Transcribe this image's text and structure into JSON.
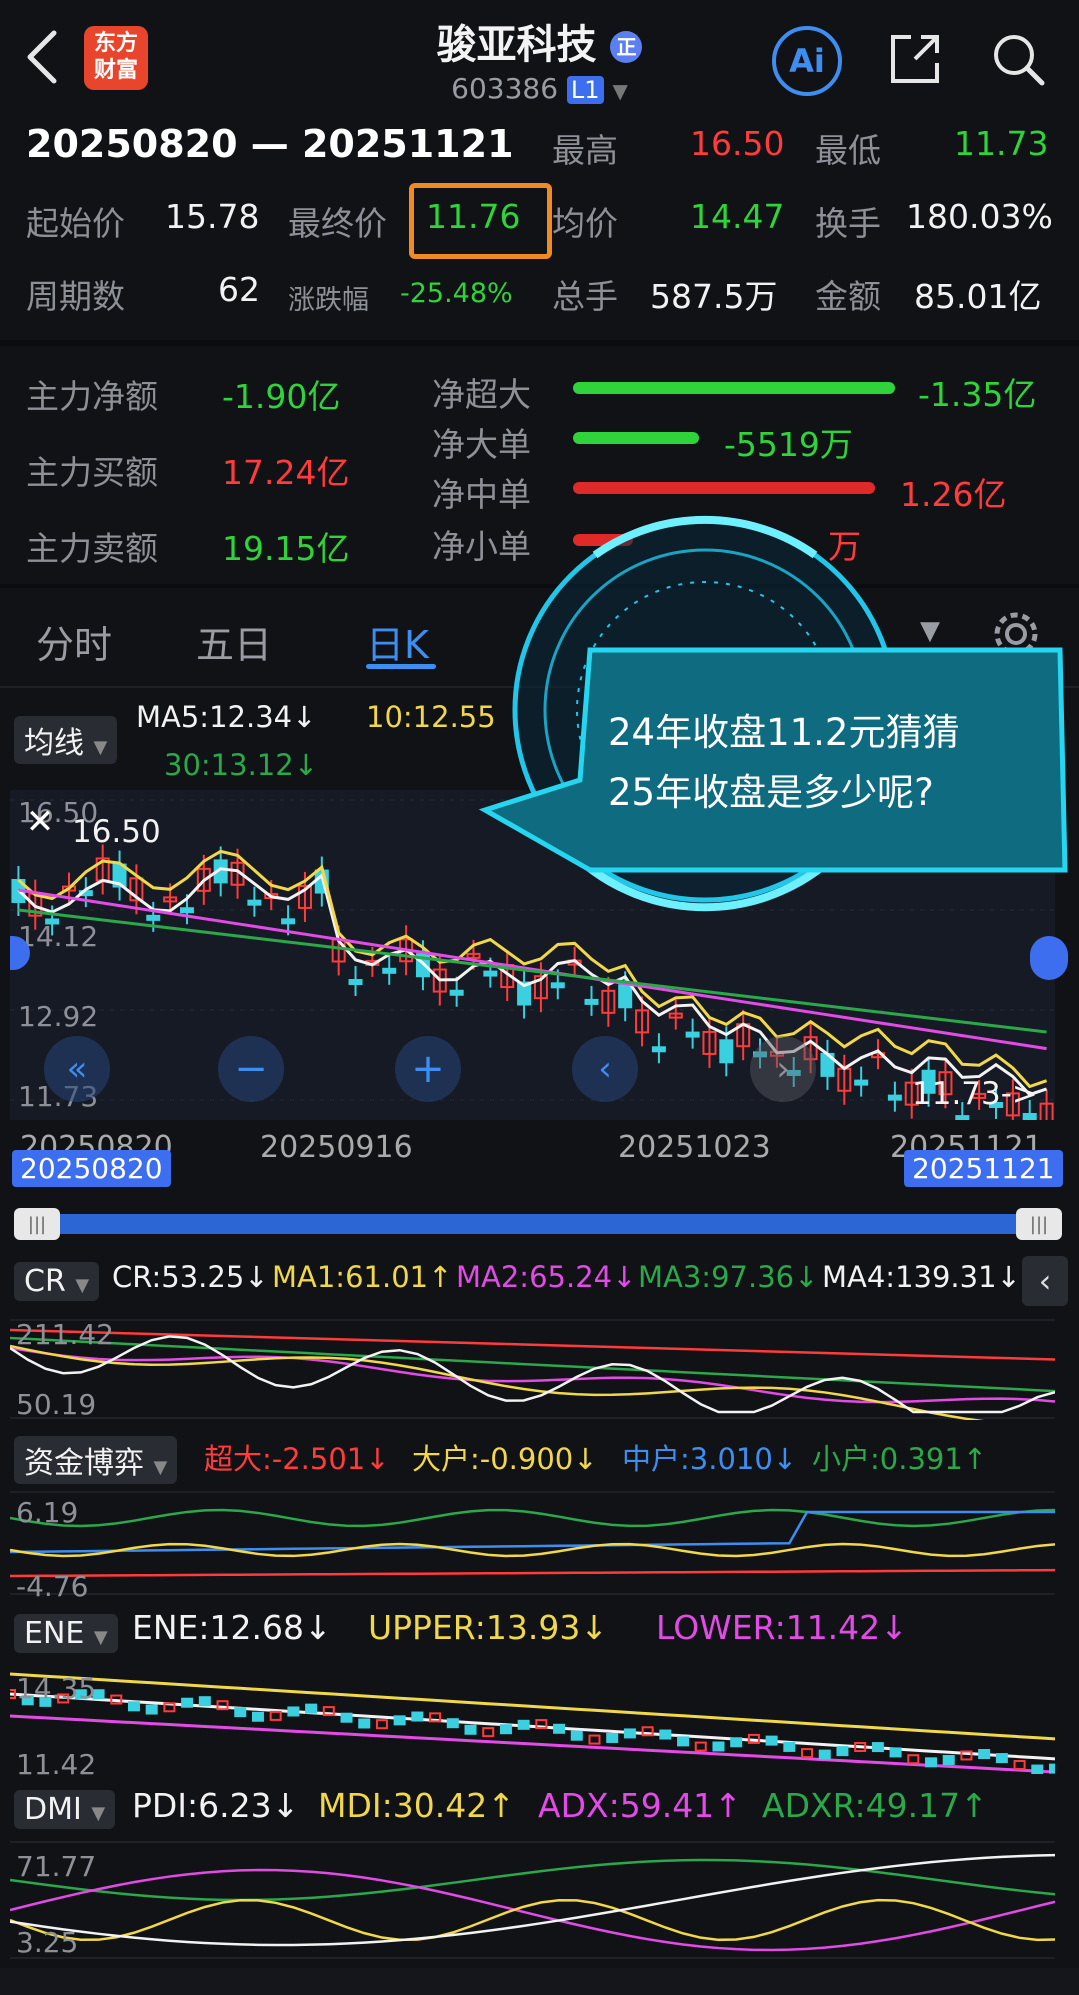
{
  "header": {
    "title": "骏亚科技",
    "title_badge": "正",
    "code": "603386",
    "level": "L1",
    "logo_line1": "东方",
    "logo_line2": "财富",
    "ai_label": "Ai"
  },
  "summary": {
    "range": "20250820 — 20251121",
    "high_label": "最高",
    "high_value": "16.50",
    "low_label": "最低",
    "low_value": "11.73",
    "start_label": "起始价",
    "start_value": "15.78",
    "end_label": "最终价",
    "end_value": "11.76",
    "avg_label": "均价",
    "avg_value": "14.47",
    "turnover_label": "换手",
    "turnover_value": "180.03%",
    "periods_label": "周期数",
    "periods_value": "62",
    "change_label": "涨跌幅",
    "change_value": "-25.48%",
    "volume_label": "总手",
    "volume_value": "587.5万",
    "amount_label": "金额",
    "amount_value": "85.01亿"
  },
  "flows": {
    "net_label": "主力净额",
    "net_value": "-1.90亿",
    "buy_label": "主力买额",
    "buy_value": "17.24亿",
    "sell_label": "主力卖额",
    "sell_value": "19.15亿",
    "items": [
      {
        "label": "净超大",
        "value": "-1.35亿",
        "color": "#2fd33a"
      },
      {
        "label": "净大单",
        "value": "-5519万",
        "color": "#2fd33a"
      },
      {
        "label": "净中单",
        "value": "1.26亿",
        "color": "#ff3b3b"
      },
      {
        "label": "净小单",
        "value": "万",
        "color": "#ff3b3b"
      }
    ]
  },
  "tabs": [
    "分时",
    "五日",
    "日K"
  ],
  "active_tab": "日K",
  "main_chart": {
    "ma_chip": "均线",
    "ma5": "MA5:12.34↓",
    "ma10": "10:12.55",
    "ma30": "30:13.12↓",
    "y_labels": [
      "16.50",
      "14.12",
      "12.92",
      "11.73"
    ],
    "high_marker": "16.50",
    "low_marker": "11.73->",
    "x_labels": [
      "20250820",
      "20250916",
      "20251023",
      "20251121"
    ],
    "range_start": "20250820",
    "range_end": "20251121",
    "watermark": "东方财富"
  },
  "tooltip": {
    "line1": "24年收盘11.2元猜猜",
    "line2": "25年收盘是多少呢?"
  },
  "cr": {
    "chip": "CR",
    "values": [
      "CR:53.25↓",
      "MA1:61.01↑",
      "MA2:65.24↓",
      "MA3:97.36↓",
      "MA4:139.31↓"
    ],
    "y_top": "211.42",
    "y_bottom": "50.19"
  },
  "funds": {
    "chip": "资金博弈",
    "values": [
      "超大:-2.501↓",
      "大户:-0.900↓",
      "中户:3.010↓",
      "小户:0.391↑"
    ],
    "y_top": "6.19",
    "y_bottom": "-4.76"
  },
  "ene": {
    "chip": "ENE",
    "values": [
      "ENE:12.68↓",
      "UPPER:13.93↓",
      "LOWER:11.42↓"
    ],
    "y_top": "14.35",
    "y_bottom": "11.42"
  },
  "dmi": {
    "chip": "DMI",
    "values": [
      "PDI:6.23↓",
      "MDI:30.42↑",
      "ADX:59.41↑",
      "ADXR:49.17↑"
    ],
    "y_top": "71.77",
    "y_bottom": "3.25"
  },
  "colors": {
    "up": "#ff3b3b",
    "down": "#2fd33a",
    "accent": "#3e8ef2",
    "ma5": "#f2f2f2",
    "ma10": "#f0d84a",
    "ma30": "#e24be6",
    "ma60": "#2aa84a",
    "highlight_box": "#f08a24",
    "tooltip": "#0e6b80"
  }
}
